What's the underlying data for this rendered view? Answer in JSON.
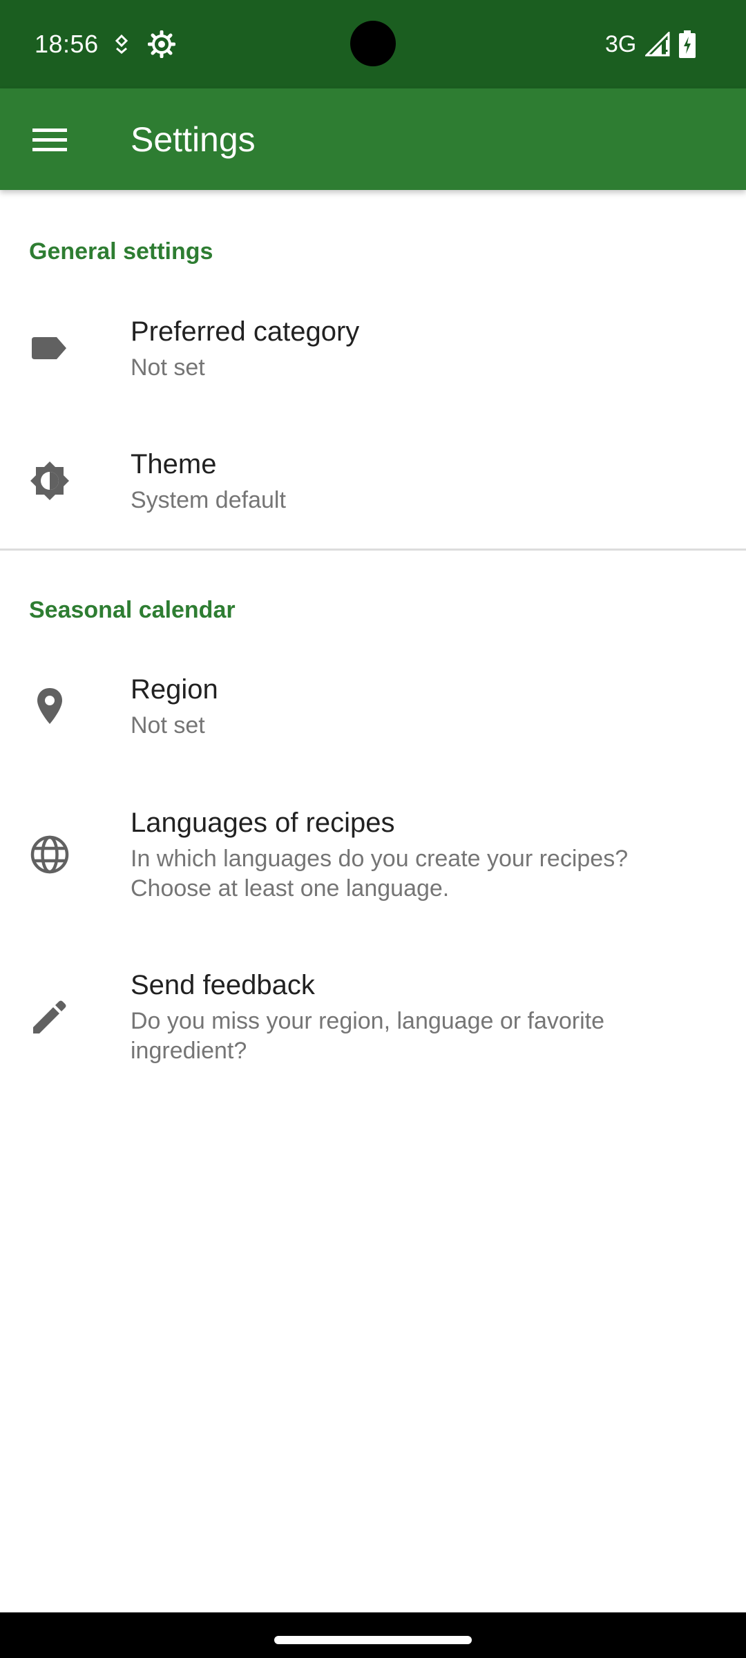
{
  "status_bar": {
    "time": "18:56",
    "network": "3G",
    "icons": [
      "notification-icon",
      "settings-gear-icon",
      "signal-icon",
      "battery-charging-icon"
    ]
  },
  "app_bar": {
    "title": "Settings",
    "menu_icon": "hamburger-menu-icon",
    "color": "#2e7d32",
    "status_color": "#1b5e20"
  },
  "sections": [
    {
      "header": "General settings",
      "items": [
        {
          "icon": "label-icon",
          "title": "Preferred category",
          "summary": "Not set"
        },
        {
          "icon": "brightness-icon",
          "title": "Theme",
          "summary": "System default"
        }
      ]
    },
    {
      "header": "Seasonal calendar",
      "items": [
        {
          "icon": "location-pin-icon",
          "title": "Region",
          "summary": "Not set"
        },
        {
          "icon": "globe-icon",
          "title": "Languages of recipes",
          "summary": "In which languages do you create your recipes? Choose at least one language."
        },
        {
          "icon": "pencil-icon",
          "title": "Send feedback",
          "summary": "Do you miss your region, language or favorite ingredient?"
        }
      ]
    }
  ]
}
